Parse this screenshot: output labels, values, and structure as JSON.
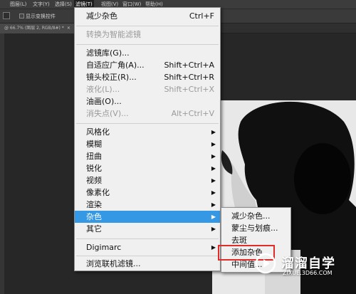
{
  "menubar": {
    "items": [
      "图层(L)",
      "文字(Y)",
      "选择(S)",
      "滤镜(T)",
      "视图(V)",
      "窗口(W)",
      "帮助(H)"
    ],
    "active": "滤镜(T)"
  },
  "options": {
    "transform_label": "显示变换控件"
  },
  "document_tab": {
    "label": "@ 66.7% (图层 2, RGB/8#) *",
    "close": "×"
  },
  "filter_menu": {
    "last_filter": {
      "label": "减少杂色",
      "shortcut": "Ctrl+F"
    },
    "smart": {
      "label": "转换为智能滤镜"
    },
    "gallery": {
      "label": "滤镜库(G)..."
    },
    "adaptive": {
      "label": "自适应广角(A)...",
      "shortcut": "Shift+Ctrl+A"
    },
    "lens": {
      "label": "镜头校正(R)...",
      "shortcut": "Shift+Ctrl+R"
    },
    "liquify": {
      "label": "液化(L)...",
      "shortcut": "Shift+Ctrl+X"
    },
    "oil": {
      "label": "油画(O)..."
    },
    "vanish": {
      "label": "消失点(V)...",
      "shortcut": "Alt+Ctrl+V"
    },
    "stylize": {
      "label": "风格化"
    },
    "blur": {
      "label": "模糊"
    },
    "distort": {
      "label": "扭曲"
    },
    "sharpen": {
      "label": "锐化"
    },
    "video": {
      "label": "视频"
    },
    "pixelate": {
      "label": "像素化"
    },
    "render": {
      "label": "渲染"
    },
    "noise": {
      "label": "杂色"
    },
    "other": {
      "label": "其它"
    },
    "digimarc": {
      "label": "Digimarc"
    },
    "browse": {
      "label": "浏览联机滤镜..."
    },
    "submenu_arrow": "▶"
  },
  "noise_submenu": {
    "items": [
      "减少杂色...",
      "蒙尘与划痕...",
      "去斑",
      "添加杂色...",
      "中间值..."
    ]
  },
  "watermark": {
    "title": "溜溜自学",
    "url": "ZIXUE.3D66.COM"
  },
  "colors": {
    "highlight": "#3598e4",
    "callout": "#e12c2c"
  }
}
